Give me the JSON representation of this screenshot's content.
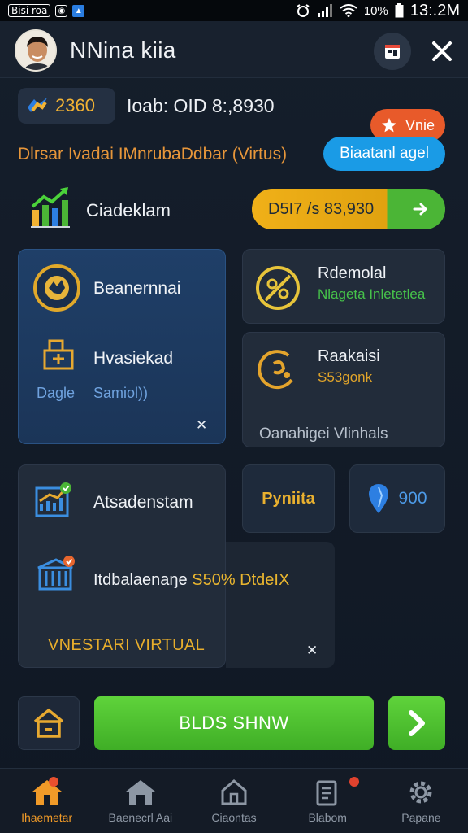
{
  "status_bar": {
    "left_chip": "Bisi roa",
    "time": "13:.2M",
    "battery": "10%"
  },
  "header": {
    "user_name": "NNina kiia"
  },
  "wallet": {
    "coins": "2360",
    "balance_text": "Ioab: OID 8:,8930",
    "vip_label": "Vnie"
  },
  "promo": {
    "text": "Dlrsar Ivadai IMnrubaDdbar (Virtus)",
    "button_label": "Biaatanl agel"
  },
  "chart_row": {
    "title": "Ciadeklam",
    "cta_value": "D5I7 /s 83,930"
  },
  "card_left": {
    "title1": "Beanernnai",
    "title2": "Hvasiekad",
    "sub_a": "Dagle",
    "sub_b": "Samiol))",
    "close": "✕"
  },
  "card_right_top": {
    "title": "Rdemolal",
    "subtitle": "Nlageta Inletetlea"
  },
  "card_right_mid": {
    "title": "Raakaisi",
    "subtitle": "S53gonk",
    "footer": "Oanahigei Vlinhals"
  },
  "card_big": {
    "title1": "Atsadenstam",
    "line2_prefix": "Itdbalaenaŋe",
    "line2_highlight": "S50% DtdeIX",
    "footer": "VNESTARI VIRTUAL",
    "close": "✕"
  },
  "mini_tiles": {
    "tile1_label": "Pyniita",
    "tile2_label": "900"
  },
  "action_bar": {
    "main_button": "BLDS SHNW"
  },
  "bottom_nav": [
    {
      "label": "Ihaemetar",
      "icon": "home-icon"
    },
    {
      "label": "Baenecrl Aai",
      "icon": "store-icon"
    },
    {
      "label": "Ciaontas",
      "icon": "house-outline-icon"
    },
    {
      "label": "Blabom",
      "icon": "receipt-icon"
    },
    {
      "label": "Papane",
      "icon": "settings-icon"
    }
  ],
  "colors": {
    "accent_orange": "#f09a28",
    "gold": "#f2b233",
    "green": "#4bb536",
    "blue": "#1a9be6",
    "vip_orange": "#e85a2a"
  }
}
